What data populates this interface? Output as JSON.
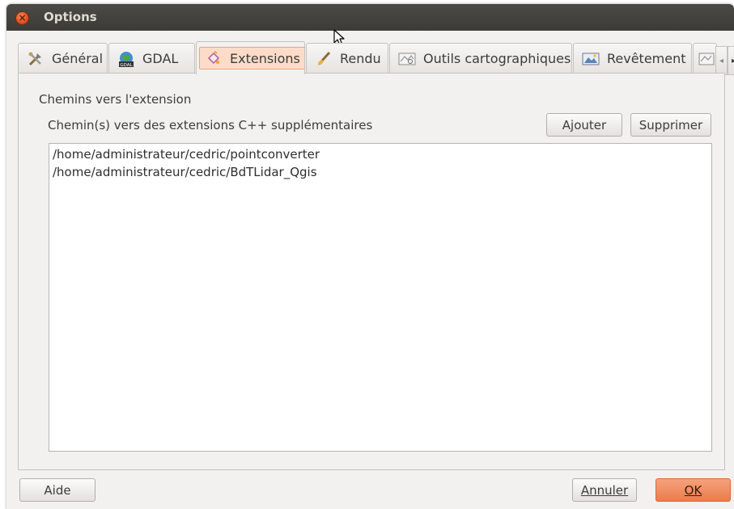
{
  "window": {
    "title": "Options",
    "close_glyph": "×"
  },
  "tabs": [
    {
      "label": "Général",
      "icon": "tools-icon",
      "active": false
    },
    {
      "label": "GDAL",
      "icon": "gdal-icon",
      "active": false
    },
    {
      "label": "Extensions",
      "icon": "plugin-icon",
      "active": true
    },
    {
      "label": "Rendu",
      "icon": "brush-icon",
      "active": false
    },
    {
      "label": "Outils cartographiques",
      "icon": "map-tools-icon",
      "active": false
    },
    {
      "label": "Revêtement",
      "icon": "overlay-icon",
      "active": false
    }
  ],
  "tab_scroll": {
    "left": "◂",
    "right": "▸"
  },
  "extensions": {
    "group_title": "Chemins vers l'extension",
    "paths_label": "Chemin(s) vers des extensions C++ supplémentaires",
    "add_label": "Ajouter",
    "remove_label": "Supprimer",
    "paths": [
      "/home/administrateur/cedric/pointconverter",
      "/home/administrateur/cedric/BdTLidar_Qgis"
    ]
  },
  "footer": {
    "help_label": "Aide",
    "cancel_label": "Annuler",
    "ok_label": "OK"
  },
  "colors": {
    "accent": "#ea7d4d",
    "titlebar": "#3c3b37",
    "active_tab_highlight": "#fcdcc8"
  }
}
